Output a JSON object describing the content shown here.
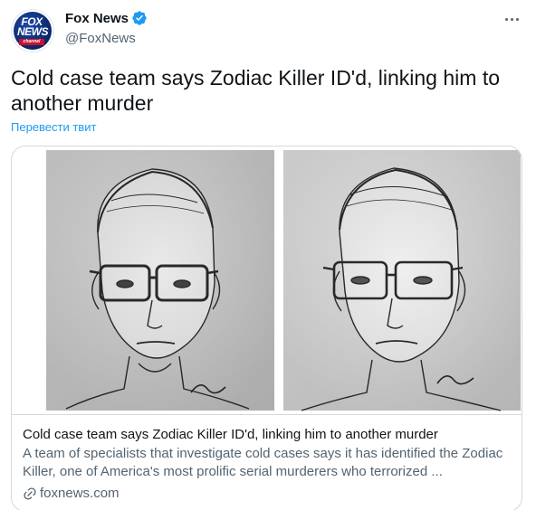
{
  "author": {
    "display_name": "Fox News",
    "handle": "@FoxNews",
    "avatar_logo_text": "FOX NEWS",
    "avatar_sub_text": "channel",
    "verified_icon": "verified-badge-icon"
  },
  "tweet": {
    "text": "Cold case team says Zodiac Killer ID'd, linking him to another murder",
    "translate_label": "Перевести твит"
  },
  "card": {
    "title": "Cold case team says Zodiac Killer ID'd, linking him to another murder",
    "description": "A team of specialists that investigate cold cases says it has identified the Zodiac Killer, one of America's most prolific serial murderers who terrorized ...",
    "domain": "foxnews.com",
    "image_description_icon": "police-sketch-image"
  },
  "colors": {
    "link_blue": "#1d9bf0",
    "secondary_text": "#536471",
    "border": "#cfd9de",
    "fox_blue": "#0a2566",
    "fox_red": "#c8102e"
  }
}
